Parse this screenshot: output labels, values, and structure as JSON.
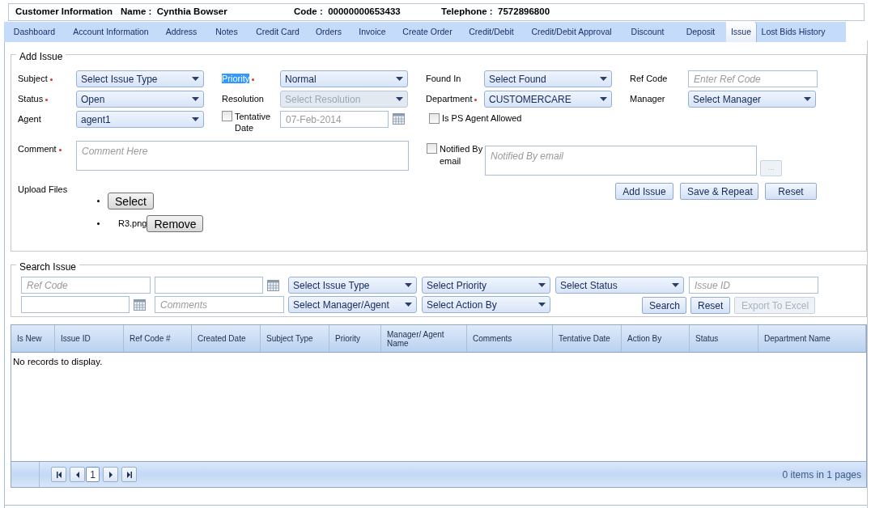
{
  "header": [
    {
      "label": "Customer Information"
    },
    {
      "label": "Name :",
      "value": "Cynthia Bowser"
    },
    {
      "label": "Code :",
      "value": "00000000653433"
    },
    {
      "label": "Telephone :",
      "value": "7572896800"
    }
  ],
  "tabs": [
    {
      "label": "Dashboard",
      "selected": false
    },
    {
      "label": "Account Information",
      "selected": false
    },
    {
      "label": "Address",
      "selected": false
    },
    {
      "label": "Notes",
      "selected": false
    },
    {
      "label": "Credit Card",
      "selected": false
    },
    {
      "label": "Orders",
      "selected": false
    },
    {
      "label": "Invoice",
      "selected": false
    },
    {
      "label": "Create Order",
      "selected": false
    },
    {
      "label": "Credit/Debit",
      "selected": false
    },
    {
      "label": "Credit/Debit Approval",
      "selected": false
    },
    {
      "label": "Discount",
      "selected": false
    },
    {
      "label": "Deposit",
      "selected": false
    },
    {
      "label": "Issue",
      "selected": true
    },
    {
      "label": "Lost Bids History",
      "selected": false
    }
  ],
  "add_issue": {
    "title": "Add Issue",
    "rows": [
      [
        {
          "kind": "select",
          "label": "Subject",
          "required": true,
          "highlighted": false,
          "value": "Select Issue Type",
          "disabled": false
        },
        {
          "kind": "select",
          "label": "Priority",
          "required": true,
          "highlighted": true,
          "value": "Normal",
          "disabled": false
        },
        {
          "kind": "select",
          "label": "Found In",
          "required": false,
          "highlighted": false,
          "value": "Select Found",
          "disabled": false
        },
        {
          "kind": "text",
          "label": "Ref Code",
          "required": false,
          "highlighted": false,
          "placeholder": "Enter Ref Code"
        }
      ],
      [
        {
          "kind": "select",
          "label": "Status",
          "required": true,
          "highlighted": false,
          "value": "Open",
          "disabled": false
        },
        {
          "kind": "select",
          "label": "Resolution",
          "required": false,
          "highlighted": false,
          "value": "Select Resolution",
          "disabled": true
        },
        {
          "kind": "select",
          "label": "Department",
          "required": true,
          "highlighted": false,
          "value": "CUSTOMERCARE",
          "disabled": false
        },
        {
          "kind": "select",
          "label": "Manager",
          "required": false,
          "highlighted": false,
          "value": "Select Manager",
          "disabled": false
        }
      ],
      [
        {
          "kind": "select",
          "label": "Agent",
          "required": false,
          "highlighted": false,
          "value": "agent1",
          "disabled": false
        },
        {
          "kind": "check_date",
          "label": "Tentative Date",
          "checked": false,
          "value": "07-Feb-2014",
          "disabled": true
        },
        {
          "kind": "checkbox",
          "label": "Is PS Agent Allowed",
          "checked": false
        }
      ]
    ],
    "comment": {
      "label": "Comment",
      "required": true,
      "placeholder": "Comment Here"
    },
    "notified": {
      "label": "Notified By email",
      "checked": false,
      "placeholder": "Notified By email",
      "button": "..."
    },
    "upload": {
      "label": "Upload Files",
      "select_button": "Select",
      "files": [
        {
          "name": "R3.png",
          "button": "Remove"
        }
      ]
    },
    "buttons": [
      "Add Issue",
      "Save & Repeat",
      "Reset"
    ]
  },
  "search_issue": {
    "title": "Search Issue",
    "row_1": [
      {
        "kind": "text",
        "placeholder": "Ref Code"
      },
      {
        "kind": "date"
      },
      {
        "kind": "select",
        "value": "Select Issue Type"
      },
      {
        "kind": "select",
        "value": "Select Priority"
      },
      {
        "kind": "select",
        "value": "Select Status"
      },
      {
        "kind": "text",
        "placeholder": "Issue ID"
      }
    ],
    "row_2": [
      {
        "kind": "date"
      },
      {
        "kind": "text",
        "placeholder": "Comments"
      },
      {
        "kind": "select",
        "value": "Select Manager/Agent"
      },
      {
        "kind": "select",
        "value": "Select Action By"
      }
    ],
    "buttons": [
      {
        "label": "Search",
        "disabled": false
      },
      {
        "label": "Reset",
        "disabled": false
      },
      {
        "label": "Export To Excel",
        "disabled": true
      }
    ]
  },
  "table": {
    "columns": [
      "Is New",
      "Issue ID",
      "Ref Code #",
      "Created Date",
      "Subject Type",
      "Priority",
      "Manager/ Agent Name",
      "Comments",
      "Tentative Date",
      "Action By",
      "Status",
      "Department Name"
    ],
    "empty_text": "No records to display.",
    "pager": {
      "page": "1",
      "summary": "0 items in 1 pages"
    }
  }
}
